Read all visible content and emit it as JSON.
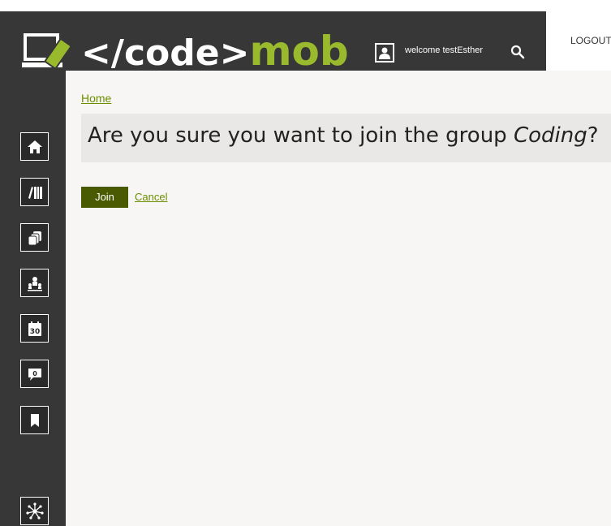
{
  "header": {
    "logo_code": "</code>",
    "logo_mob": "mob",
    "welcome": "welcome testEsther",
    "logout": "LOGOUT",
    "logo_icon": "laptop-phone-icon",
    "user_icon": "user-icon",
    "search_icon": "search-icon"
  },
  "sidebar": {
    "items": [
      {
        "name": "home",
        "icon": "home-icon"
      },
      {
        "name": "library",
        "icon": "books-icon"
      },
      {
        "name": "cards",
        "icon": "cards-icon"
      },
      {
        "name": "groups",
        "icon": "group-icon"
      },
      {
        "name": "calendar",
        "icon": "calendar-icon",
        "text": "30"
      },
      {
        "name": "messages",
        "icon": "speech-bubble-icon",
        "text": "0"
      },
      {
        "name": "bookmarks",
        "icon": "bookmark-icon"
      },
      {
        "name": "network",
        "icon": "network-icon"
      }
    ]
  },
  "main": {
    "breadcrumb": "Home",
    "question_prefix": "Are you sure you want to join the group ",
    "question_group": "Coding",
    "question_suffix": "?",
    "join_label": "Join",
    "cancel_label": "Cancel"
  },
  "colors": {
    "header_bg": "#373737",
    "accent_green": "#9aba2e",
    "link_green": "#6b8e00",
    "button_green": "#4a5a00",
    "main_bg": "#f7f6f4"
  }
}
